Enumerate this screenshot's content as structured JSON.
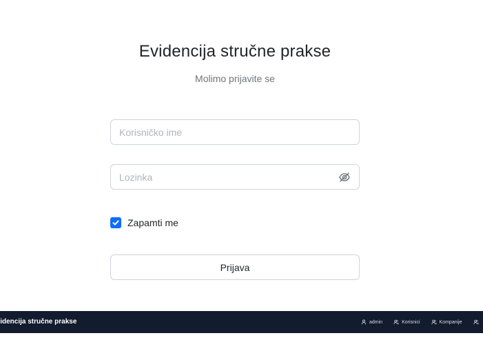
{
  "login": {
    "title": "Evidencija stručne prakse",
    "subtitle": "Molimo prijavite se",
    "username": {
      "value": "",
      "placeholder": "Korisničko ime"
    },
    "password": {
      "value": "",
      "placeholder": "Lozinka",
      "toggle_icon": "eye-slash-icon"
    },
    "remember_me": {
      "label": "Zapamti me",
      "checked": true
    },
    "submit_label": "Prijava"
  },
  "navbar": {
    "brand": "Evidencija stručne prakse",
    "links": [
      {
        "label": "admin",
        "icon": "user-icon"
      },
      {
        "label": "Korisnici",
        "icon": "users-icon"
      },
      {
        "label": "Kompanije",
        "icon": "users-icon"
      },
      {
        "label": "",
        "icon": "users-icon"
      }
    ]
  },
  "colors": {
    "accent": "#0d6efd",
    "navbar_bg": "#131b2e"
  }
}
